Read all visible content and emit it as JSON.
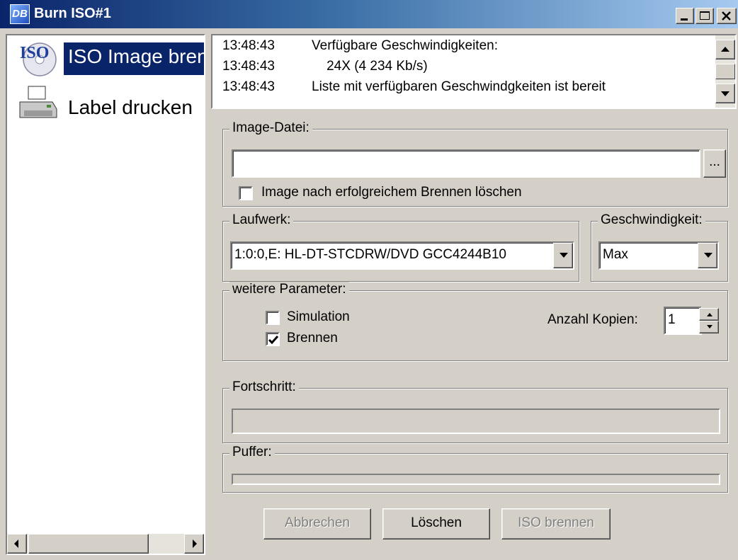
{
  "window": {
    "title": "Burn ISO#1",
    "app_icon_text": "DB",
    "title_bar_colors": [
      "#0a246a",
      "#a6caf0"
    ],
    "controls": [
      "minimize-icon",
      "maximize-icon",
      "close-icon"
    ]
  },
  "sidebar": {
    "items": [
      {
        "label": "ISO Image brennen",
        "icon": "iso-disc-icon",
        "icon_text": "ISO",
        "selected": true
      },
      {
        "label": "Label drucken",
        "icon": "printer-icon",
        "selected": false
      }
    ]
  },
  "log": {
    "rows": [
      {
        "time": "13:48:43",
        "message": "Verfügbare Geschwindigkeiten:"
      },
      {
        "time": "13:48:43",
        "message": "    24X (4 234 Kb/s)"
      },
      {
        "time": "13:48:43",
        "message": "Liste mit verfügbaren Geschwindgkeiten ist bereit"
      }
    ]
  },
  "image_file": {
    "group_label": "Image-Datei:",
    "path_value": "",
    "browse_label": "...",
    "delete_after_label": "Image nach erfolgreichem Brennen löschen",
    "delete_after_checked": false
  },
  "drive": {
    "group_label": "Laufwerk:",
    "selected": "1:0:0,E: HL-DT-STCDRW/DVD GCC4244B10"
  },
  "speed": {
    "group_label": "Geschwindigkeit:",
    "selected": "Max"
  },
  "params": {
    "group_label": "weitere Parameter:",
    "simulation_label": "Simulation",
    "simulation_checked": false,
    "burn_label": "Brennen",
    "burn_checked": true,
    "copies_label": "Anzahl Kopien:",
    "copies_value": "1"
  },
  "progress": {
    "group_label": "Fortschritt:",
    "value": 0
  },
  "buffer": {
    "group_label": "Puffer:",
    "value": 0
  },
  "buttons": {
    "cancel_label": "Abbrechen",
    "cancel_enabled": false,
    "clear_label": "Löschen",
    "clear_enabled": true,
    "burn_label": "ISO brennen",
    "burn_enabled": false
  },
  "colors": {
    "face": "#d4d0c8",
    "selection": "#0a246a",
    "disabled_text": "#808080"
  }
}
